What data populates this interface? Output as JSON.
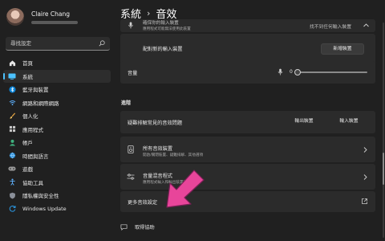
{
  "profile": {
    "name": "Claire Chang"
  },
  "search": {
    "placeholder": "尋找設定"
  },
  "sidebar": {
    "items": [
      {
        "label": "首頁",
        "icon": "home-icon"
      },
      {
        "label": "系統",
        "icon": "system-icon",
        "active": true
      },
      {
        "label": "藍牙與裝置",
        "icon": "bluetooth-icon"
      },
      {
        "label": "網路和網際網路",
        "icon": "network-icon"
      },
      {
        "label": "個人化",
        "icon": "brush-icon"
      },
      {
        "label": "應用程式",
        "icon": "apps-icon"
      },
      {
        "label": "帳戶",
        "icon": "account-icon"
      },
      {
        "label": "時間與語言",
        "icon": "globe-clock-icon"
      },
      {
        "label": "遊戲",
        "icon": "game-icon"
      },
      {
        "label": "協助工具",
        "icon": "accessibility-icon"
      },
      {
        "label": "隱私權與安全性",
        "icon": "shield-icon"
      },
      {
        "label": "Windows Update",
        "icon": "update-icon"
      }
    ]
  },
  "breadcrumb": {
    "parent": "系統",
    "separator": "›",
    "current": "音效"
  },
  "input_section": {
    "top_label": "確保你的輸入裝置",
    "top_sub": "應用程式可能無法使用此裝置",
    "top_status": "找不到任何輸入裝置",
    "pair_label": "配對新的輸入裝置",
    "pair_button": "新增裝置",
    "volume_label": "音量",
    "volume_value": "0",
    "volume_level": 0
  },
  "advanced": {
    "heading": "進階",
    "troubleshoot_label": "疑難排解常見的音效問題",
    "output_button": "輸出裝置",
    "input_button": "輸入裝置",
    "all_devices_label": "所有音效裝置",
    "all_devices_sub": "開啟/關閉裝置、疑難排解、其他選項",
    "mixer_label": "音量混音程式",
    "mixer_sub": "應用程式輸入和輸出裝置的混音器",
    "more_label": "更多音效設定"
  },
  "footer": {
    "help_label": "取得協助"
  },
  "colors": {
    "accent": "#4cc2ff",
    "arrow": "#e8459a"
  }
}
